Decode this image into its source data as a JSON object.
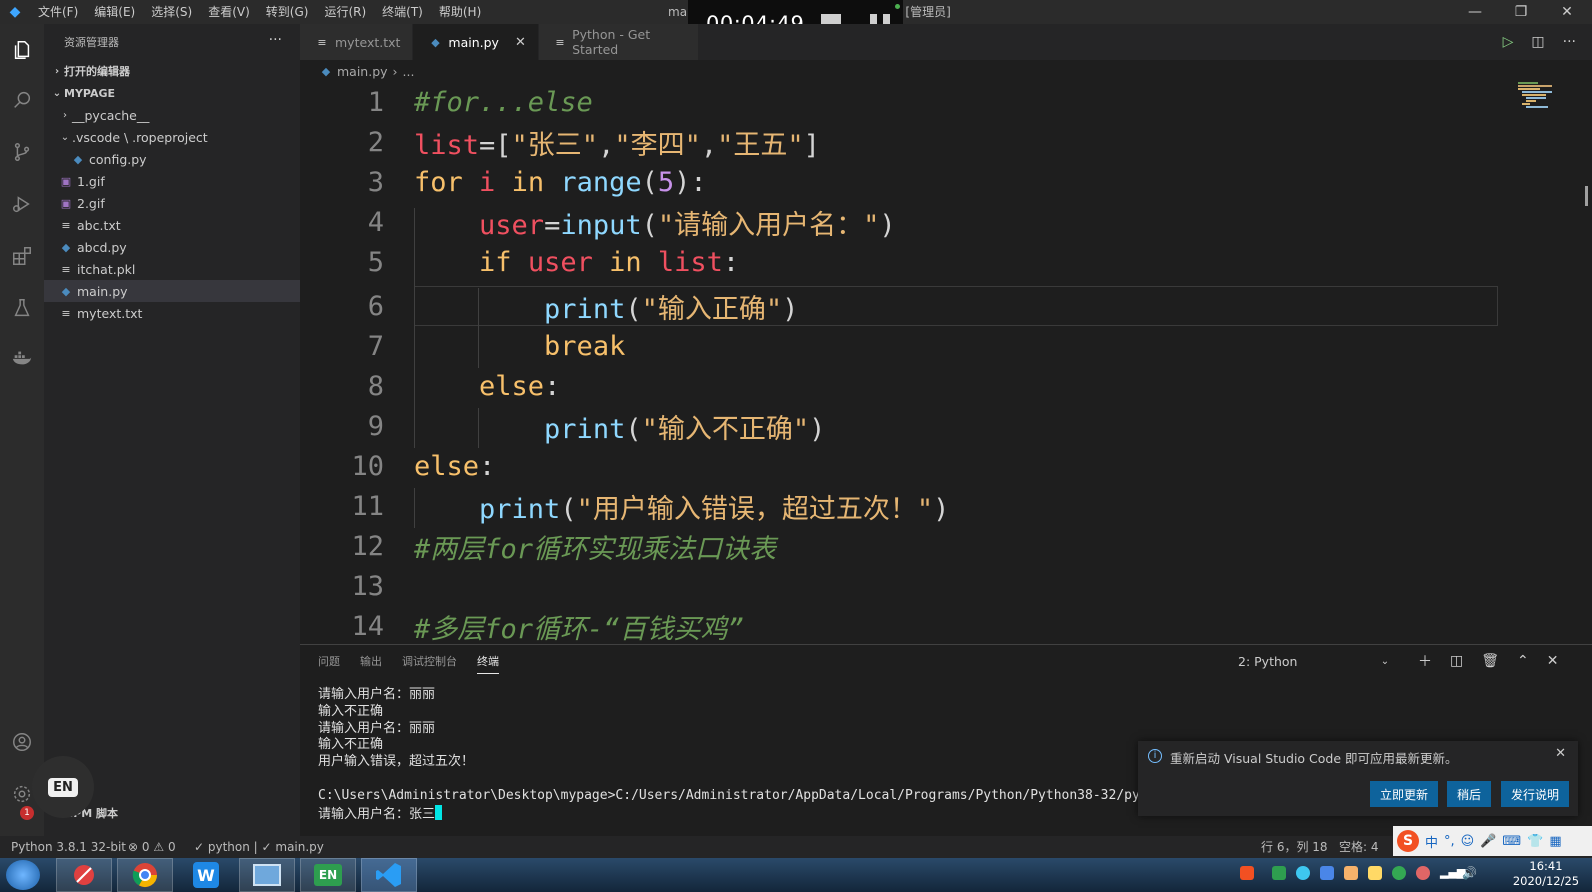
{
  "titlebar": {
    "menus": [
      "文件(F)",
      "编辑(E)",
      "选择(S)",
      "查看(V)",
      "转到(G)",
      "运行(R)",
      "终端(T)",
      "帮助(H)"
    ],
    "title": "main.py - mypage - Visual Studio Code [管理员]"
  },
  "recorder": {
    "time": "00:04:49"
  },
  "sidebar": {
    "header": "资源管理器",
    "open_editors": "打开的编辑器",
    "workspace": "MYPAGE",
    "tree": [
      {
        "label": "__pycache__",
        "type": "folder-collapsed",
        "indent": 1
      },
      {
        "label": ".vscode \\ .ropeproject",
        "type": "folder-expanded",
        "indent": 1
      },
      {
        "label": "config.py",
        "type": "py",
        "indent": 2
      },
      {
        "label": "1.gif",
        "type": "gif",
        "indent": 1
      },
      {
        "label": "2.gif",
        "type": "gif",
        "indent": 1
      },
      {
        "label": "abc.txt",
        "type": "txt",
        "indent": 1
      },
      {
        "label": "abcd.py",
        "type": "py",
        "indent": 1
      },
      {
        "label": "itchat.pkl",
        "type": "txt",
        "indent": 1
      },
      {
        "label": "main.py",
        "type": "py",
        "indent": 1,
        "selected": true
      },
      {
        "label": "mytext.txt",
        "type": "txt",
        "indent": 1
      }
    ],
    "npm_section": "NPM 脚本"
  },
  "tabs": [
    {
      "label": "mytext.txt",
      "type": "txt",
      "active": false
    },
    {
      "label": "main.py",
      "type": "py",
      "active": true
    },
    {
      "label": "Python - Get Started",
      "type": "txt",
      "active": false
    }
  ],
  "breadcrumb": {
    "file": "main.py",
    "rest": "..."
  },
  "editor": {
    "line_numbers": [
      "1",
      "2",
      "3",
      "4",
      "5",
      "6",
      "7",
      "8",
      "9",
      "10",
      "11",
      "12",
      "13",
      "14"
    ]
  },
  "panel": {
    "tabs": [
      "问题",
      "输出",
      "调试控制台",
      "终端"
    ],
    "active_tab": "终端",
    "terminal_select": "2: Python",
    "terminal_lines": [
      "请输入用户名：丽丽",
      "输入不正确",
      "请输入用户名：丽丽",
      "输入不正确",
      "用户输入错误，超过五次！",
      "",
      "C:\\Users\\Administrator\\Desktop\\mypage>C:/Users/Administrator/AppData/Local/Programs/Python/Python38-32/python.exe c:/",
      "请输入用户名：张三"
    ]
  },
  "notification": {
    "message": "重新启动 Visual Studio Code 即可应用最新更新。",
    "buttons": [
      "立即更新",
      "稍后",
      "发行说明"
    ]
  },
  "statusbar": {
    "interpreter": "Python 3.8.1 32-bit",
    "errors": "0",
    "warnings": "0",
    "checks": "✓ python | ✓ main.py",
    "position": "行 6，列 18",
    "spaces": "空格: 4"
  },
  "ime": {
    "lang": "中"
  },
  "taskbar": {
    "time": "16:41",
    "date": "2020/12/25",
    "en": "EN"
  }
}
